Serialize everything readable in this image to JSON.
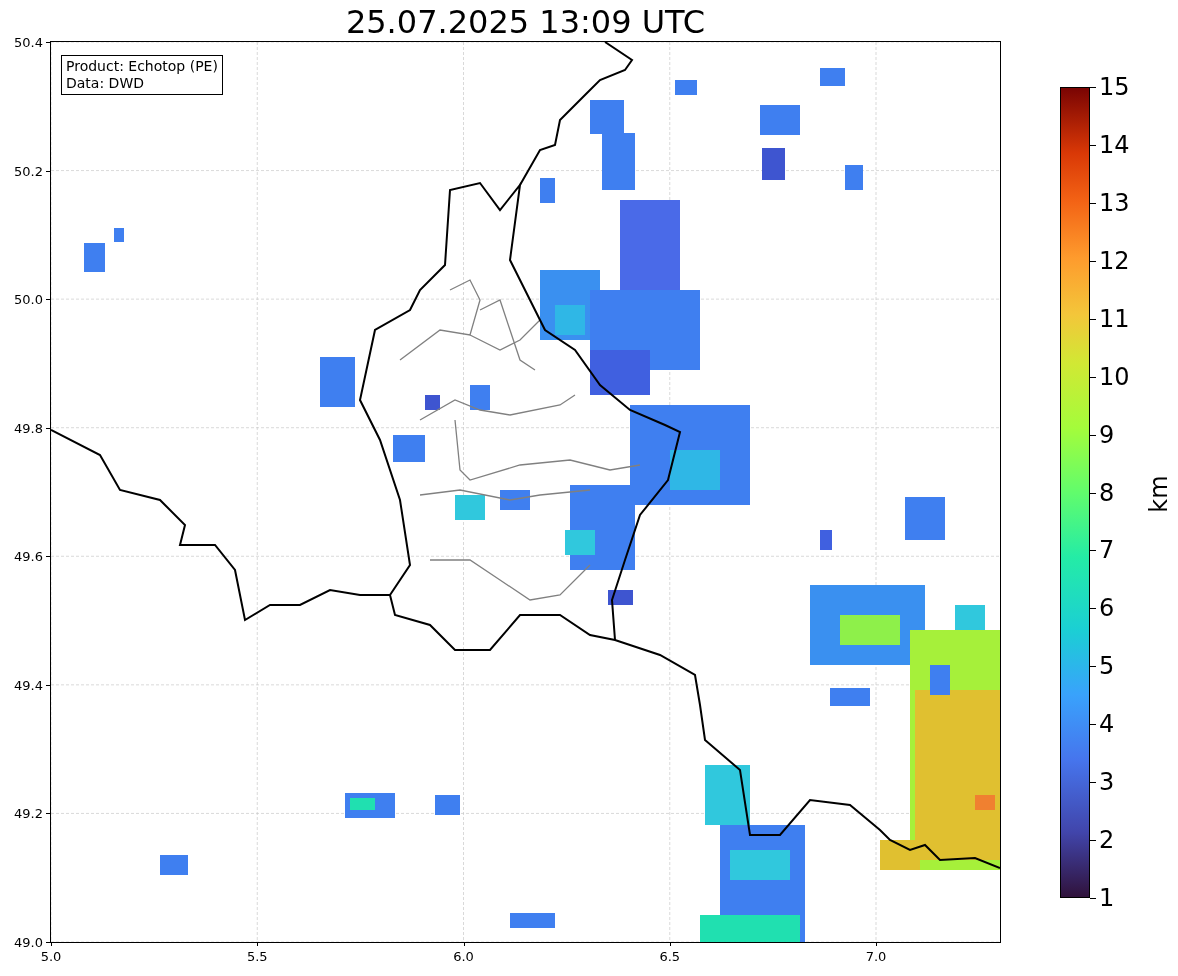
{
  "title": "25.07.2025 13:09 UTC",
  "info_box": {
    "lines": [
      "Product: Echotop (PE)",
      "Data: DWD"
    ]
  },
  "map": {
    "x_ticks": [
      "5.0",
      "5.5",
      "6.0",
      "6.5",
      "7.0"
    ],
    "y_ticks": [
      "50.4",
      "50.2",
      "50.0",
      "49.8",
      "49.6",
      "49.4",
      "49.2",
      "49.0"
    ]
  },
  "colorbar": {
    "label": "km",
    "ticks": [
      "15",
      "14",
      "13",
      "12",
      "11",
      "10",
      "9",
      "8",
      "7",
      "6",
      "5",
      "4",
      "3",
      "2",
      "1"
    ]
  }
}
